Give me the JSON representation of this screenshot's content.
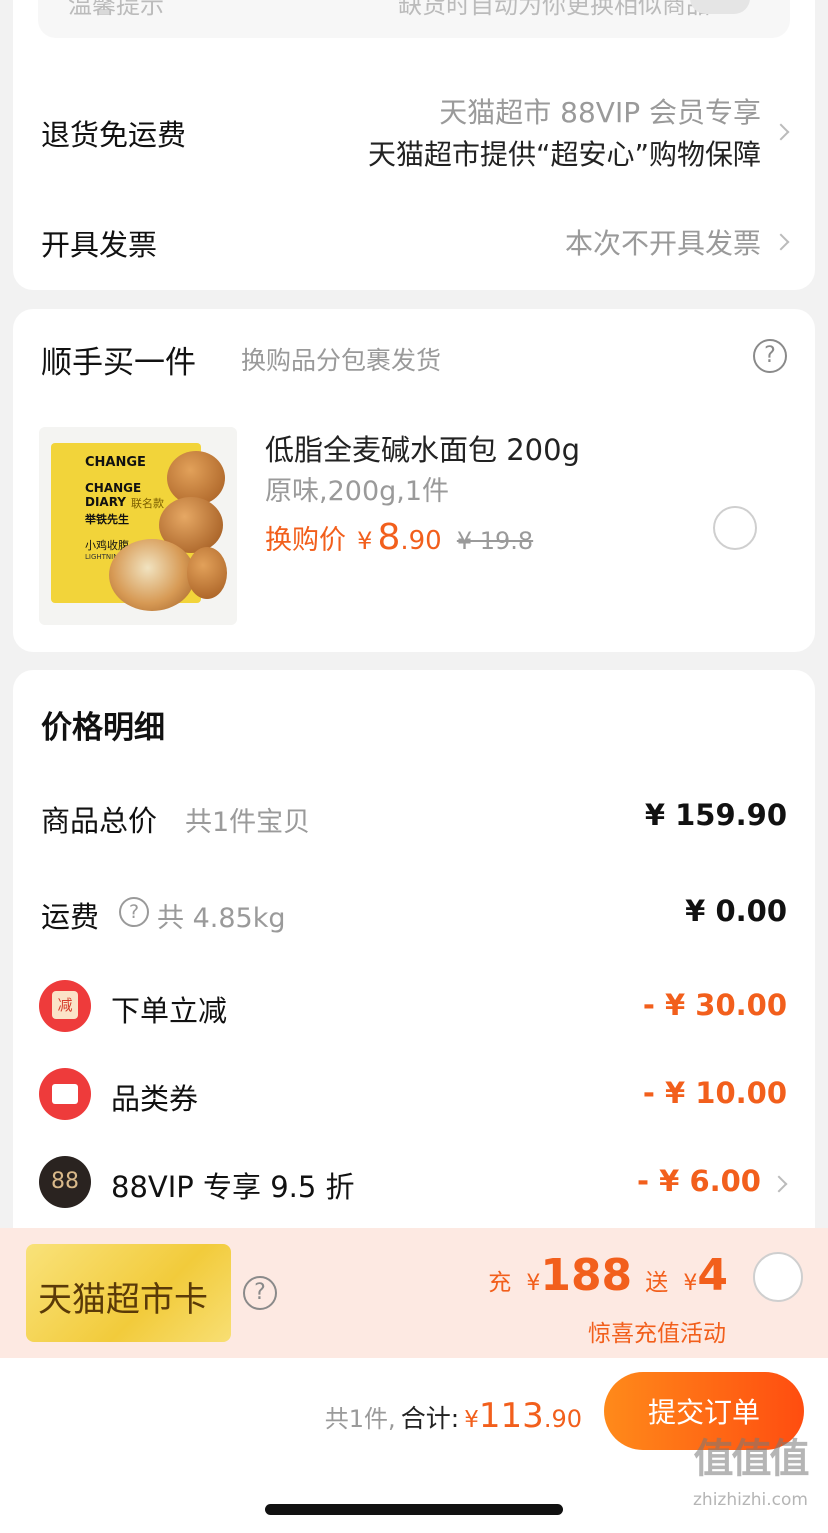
{
  "top_card": {
    "left_text": "温馨提示",
    "right_text": "缺货时自动为你更换相似商品"
  },
  "service_card": {
    "return": {
      "label": "退货免运费",
      "line1": "天猫超市 88VIP 会员专享",
      "line2": "天猫超市提供“超安心”购物保障"
    },
    "invoice": {
      "label": "开具发票",
      "value": "本次不开具发票"
    }
  },
  "addon_card": {
    "title": "顺手买一件",
    "subtitle": "换购品分包裹发货",
    "product": {
      "name": "低脂全麦碱水面包 200g",
      "spec": "原味,200g,1件",
      "price_label": "换购价",
      "currency": "¥",
      "price_int": "8",
      "price_dec": ".90",
      "orig_price": "¥ 19.8",
      "img_brand1": "CHANGE",
      "img_brand2": "DIARY",
      "img_collab": "联名款",
      "img_tag": "小鸡收腹",
      "img_sub": "LIGHTNING GIRL",
      "img_person": "举铁先生"
    }
  },
  "price_card": {
    "title": "价格明细",
    "goods_total": {
      "label": "商品总价",
      "sub": "共1件宝贝",
      "value": "¥ 159.90"
    },
    "shipping": {
      "label": "运费",
      "sub": "共 4.85kg",
      "value": "¥ 0.00"
    },
    "discounts": [
      {
        "label": "下单立减",
        "icon_text": "减",
        "value": "- ¥ 30.00"
      },
      {
        "label": "品类券",
        "icon_text": "",
        "value": "- ¥ 10.00"
      },
      {
        "label": "88VIP 专享 9.5 折",
        "icon_text": "88",
        "value": "- ¥ 6.00"
      }
    ]
  },
  "promo_bar": {
    "card_name": "天猫超市卡",
    "charge_label": "充",
    "charge_currency": "¥",
    "charge_amount": "188",
    "gift_label": "送",
    "gift_currency": "¥",
    "gift_amount": "4",
    "activity": "惊喜充值活动"
  },
  "bottom_bar": {
    "count": "共1件,",
    "total_label": "合计:",
    "currency": "¥",
    "total_int": "113",
    "total_dec": ".90",
    "submit": "提交订单"
  },
  "watermark": {
    "logo": "值值值",
    "url": "zhizhizhi.com"
  },
  "colors": {
    "accent": "#f25f1c",
    "submit_start": "#ff8a1a",
    "submit_end": "#ff4d10",
    "promo_bg": "#fde9e2",
    "discount_red": "#ee3b3b",
    "vip_dark": "#2a2320"
  }
}
